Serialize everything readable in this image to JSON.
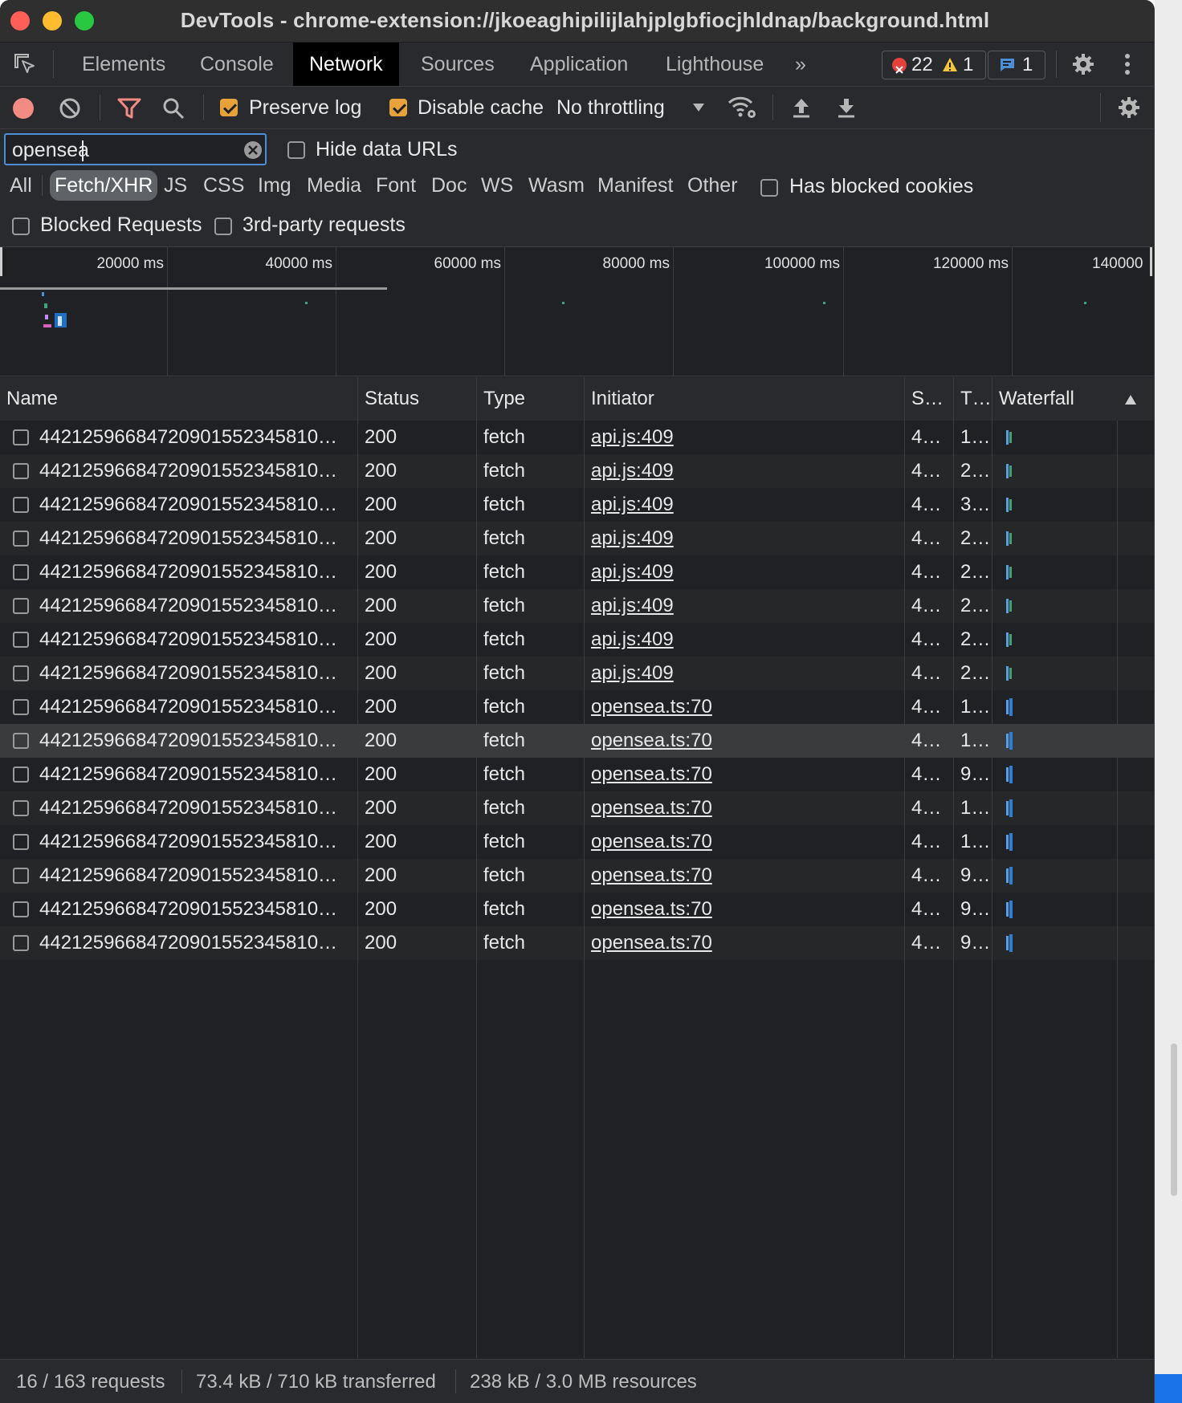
{
  "window": {
    "title": "DevTools - chrome-extension://jkoeaghipilijlahjplgbfiocjhldnap/background.html"
  },
  "tabs": [
    {
      "label": "Elements",
      "active": false
    },
    {
      "label": "Console",
      "active": false
    },
    {
      "label": "Network",
      "active": true
    },
    {
      "label": "Sources",
      "active": false
    },
    {
      "label": "Application",
      "active": false
    },
    {
      "label": "Lighthouse",
      "active": false
    }
  ],
  "tabbar": {
    "more": "»",
    "errors": "22",
    "warnings": "1",
    "messages": "1"
  },
  "toolbar": {
    "preserve_log": {
      "label": "Preserve log",
      "checked": true
    },
    "disable_cache": {
      "label": "Disable cache",
      "checked": true
    },
    "throttling": "No throttling"
  },
  "filter": {
    "value": "opensea",
    "hide_data_urls": "Hide data URLs",
    "types": [
      "All",
      "Fetch/XHR",
      "JS",
      "CSS",
      "Img",
      "Media",
      "Font",
      "Doc",
      "WS",
      "Wasm",
      "Manifest",
      "Other"
    ],
    "active_type": "Fetch/XHR",
    "has_blocked_cookies": "Has blocked cookies",
    "blocked_requests": "Blocked Requests",
    "third_party": "3rd-party requests"
  },
  "overview": {
    "ticks": [
      "20000 ms",
      "40000 ms",
      "60000 ms",
      "80000 ms",
      "100000 ms",
      "120000 ms",
      "140000"
    ]
  },
  "table": {
    "columns": [
      "Name",
      "Status",
      "Type",
      "Initiator",
      "S…",
      "T…",
      "Waterfall"
    ],
    "rows": [
      {
        "name": "44212596684720901552345810…",
        "status": "200",
        "type": "fetch",
        "initiator": "api.js:409",
        "size": "4…",
        "time": "1…"
      },
      {
        "name": "44212596684720901552345810…",
        "status": "200",
        "type": "fetch",
        "initiator": "api.js:409",
        "size": "4…",
        "time": "2…"
      },
      {
        "name": "44212596684720901552345810…",
        "status": "200",
        "type": "fetch",
        "initiator": "api.js:409",
        "size": "4…",
        "time": "3…"
      },
      {
        "name": "44212596684720901552345810…",
        "status": "200",
        "type": "fetch",
        "initiator": "api.js:409",
        "size": "4…",
        "time": "2…"
      },
      {
        "name": "44212596684720901552345810…",
        "status": "200",
        "type": "fetch",
        "initiator": "api.js:409",
        "size": "4…",
        "time": "2…"
      },
      {
        "name": "44212596684720901552345810…",
        "status": "200",
        "type": "fetch",
        "initiator": "api.js:409",
        "size": "4…",
        "time": "2…"
      },
      {
        "name": "44212596684720901552345810…",
        "status": "200",
        "type": "fetch",
        "initiator": "api.js:409",
        "size": "4…",
        "time": "2…"
      },
      {
        "name": "44212596684720901552345810…",
        "status": "200",
        "type": "fetch",
        "initiator": "api.js:409",
        "size": "4…",
        "time": "2…"
      },
      {
        "name": "44212596684720901552345810…",
        "status": "200",
        "type": "fetch",
        "initiator": "opensea.ts:70",
        "size": "4…",
        "time": "1…"
      },
      {
        "name": "44212596684720901552345810…",
        "status": "200",
        "type": "fetch",
        "initiator": "opensea.ts:70",
        "size": "4…",
        "time": "1…"
      },
      {
        "name": "44212596684720901552345810…",
        "status": "200",
        "type": "fetch",
        "initiator": "opensea.ts:70",
        "size": "4…",
        "time": "9…"
      },
      {
        "name": "44212596684720901552345810…",
        "status": "200",
        "type": "fetch",
        "initiator": "opensea.ts:70",
        "size": "4…",
        "time": "1…"
      },
      {
        "name": "44212596684720901552345810…",
        "status": "200",
        "type": "fetch",
        "initiator": "opensea.ts:70",
        "size": "4…",
        "time": "1…"
      },
      {
        "name": "44212596684720901552345810…",
        "status": "200",
        "type": "fetch",
        "initiator": "opensea.ts:70",
        "size": "4…",
        "time": "9…"
      },
      {
        "name": "44212596684720901552345810…",
        "status": "200",
        "type": "fetch",
        "initiator": "opensea.ts:70",
        "size": "4…",
        "time": "9…"
      },
      {
        "name": "44212596684720901552345810…",
        "status": "200",
        "type": "fetch",
        "initiator": "opensea.ts:70",
        "size": "4…",
        "time": "9…"
      }
    ]
  },
  "statusbar": {
    "requests": "16 / 163 requests",
    "transferred": "73.4 kB / 710 kB transferred",
    "resources": "238 kB / 3.0 MB resources"
  }
}
